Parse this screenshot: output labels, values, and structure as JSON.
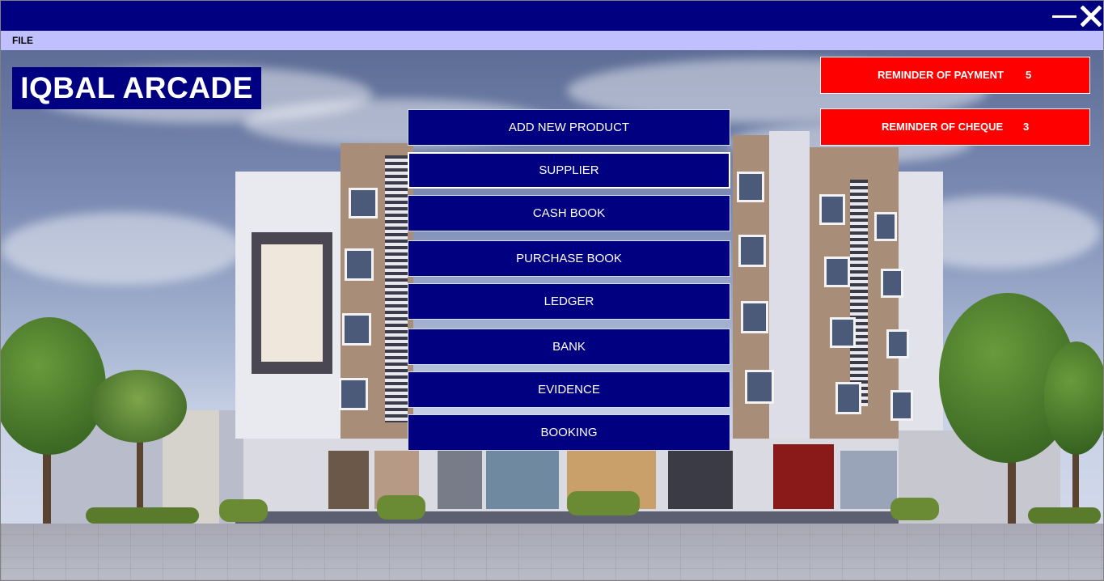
{
  "window": {
    "title_bar_color": "#000080",
    "minimize_icon": "minimize-icon",
    "close_icon": "close-icon"
  },
  "menubar": {
    "file_label": "FILE"
  },
  "logo": {
    "text": "IQBAL ARCADE"
  },
  "nav": [
    {
      "label": "ADD NEW PRODUCT"
    },
    {
      "label": "SUPPLIER"
    },
    {
      "label": "CASH BOOK"
    },
    {
      "label": "PURCHASE BOOK"
    },
    {
      "label": "LEDGER"
    },
    {
      "label": "BANK"
    },
    {
      "label": "EVIDENCE"
    },
    {
      "label": "BOOKING"
    }
  ],
  "reminders": {
    "payment": {
      "label": "REMINDER OF PAYMENT",
      "count": "5"
    },
    "cheque": {
      "label": "REMINDER OF CHEQUE",
      "count": "3"
    }
  },
  "colors": {
    "accent": "#000080",
    "alert": "#ff0000",
    "menubar": "#c0c0ff"
  }
}
